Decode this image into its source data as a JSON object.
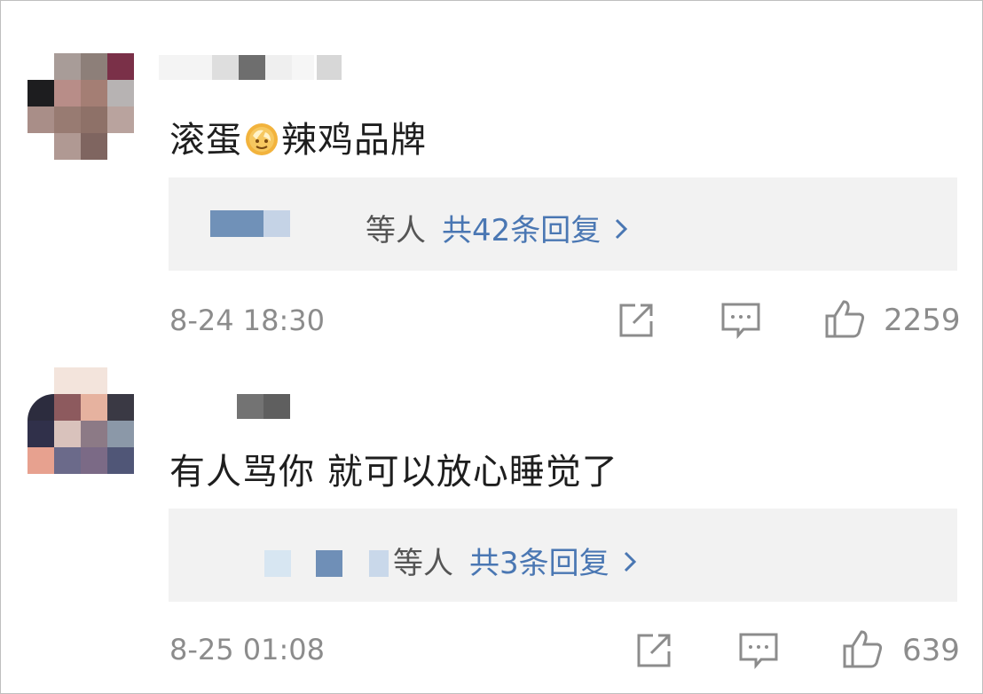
{
  "comments": [
    {
      "text_before_emoji": "滚蛋",
      "emoji": "doge-emoji",
      "text_after_emoji": "辣鸡品牌",
      "reply_by": "等人",
      "reply_count": "共42条回复",
      "timestamp": "8-24 18:30",
      "likes": "2259"
    },
    {
      "text": "有人骂你 就可以放心睡觉了",
      "reply_by": "等人",
      "reply_count": "共3条回复",
      "timestamp": "8-25 01:08",
      "likes": "639"
    }
  ],
  "icons": {
    "share": "share-icon",
    "comment": "comment-icon",
    "like": "thumbs-up-icon",
    "chevron": "chevron-right-icon"
  },
  "colors": {
    "link": "#4a77b3",
    "meta": "#8c8c8c",
    "reply_bg": "#f2f2f2"
  }
}
